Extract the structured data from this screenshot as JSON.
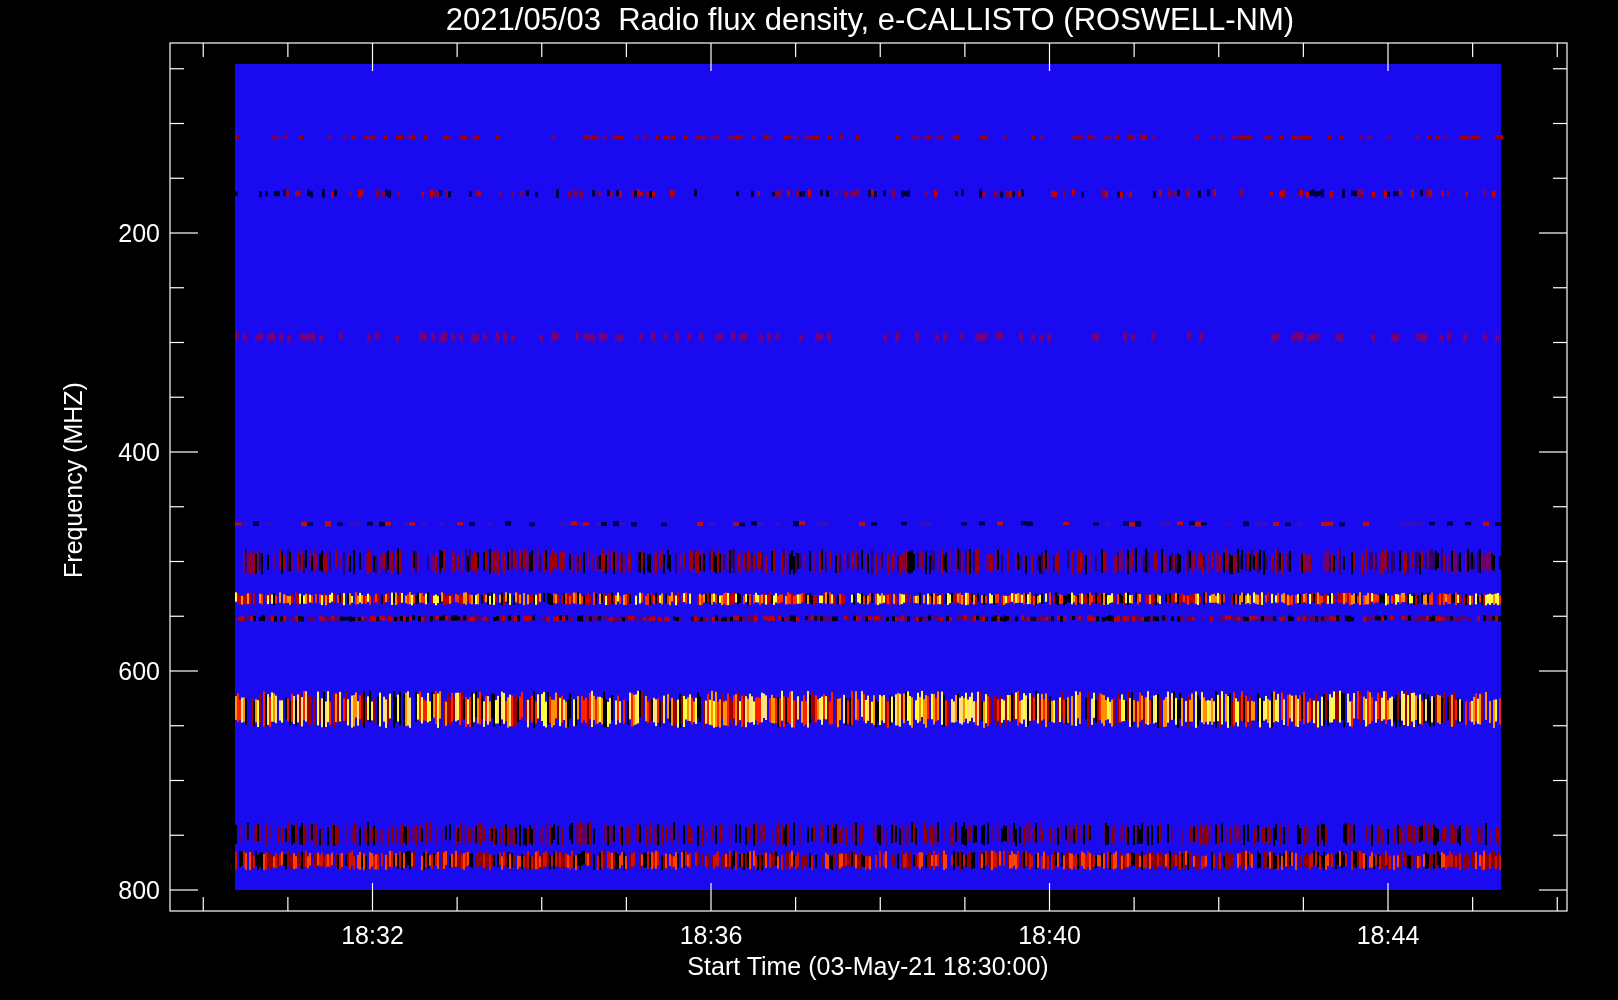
{
  "title": "2021/05/03  Radio flux density, e-CALLISTO (ROSWELL-NM)",
  "y_axis": {
    "label": "Frequency (MHZ)",
    "ticks": [
      "200",
      "400",
      "600",
      "800"
    ]
  },
  "x_axis": {
    "label": "Start Time (03-May-21 18:30:00)",
    "ticks": [
      "18:32",
      "18:36",
      "18:40",
      "18:44"
    ]
  }
}
